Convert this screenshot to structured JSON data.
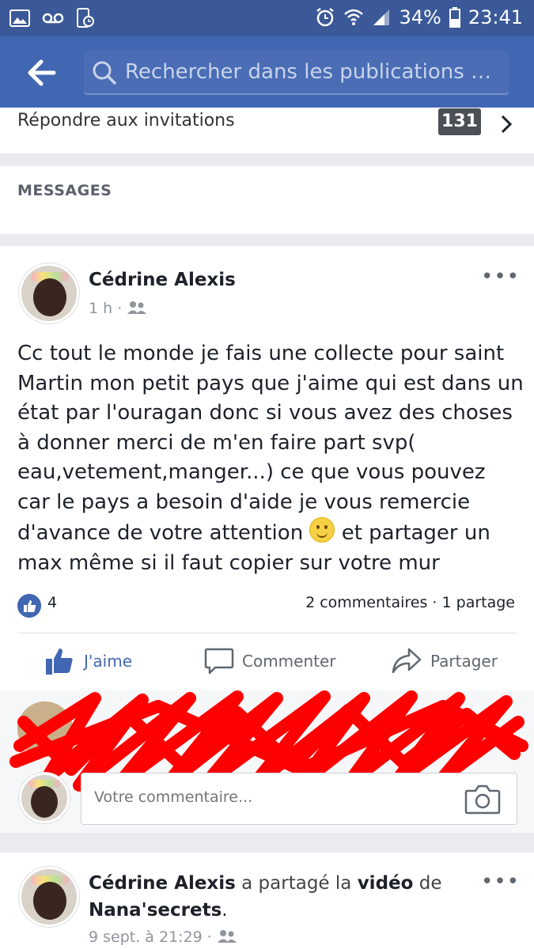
{
  "status_bar": {
    "battery": "34%",
    "time": "23:41"
  },
  "search": {
    "placeholder": "Rechercher dans les publications de..."
  },
  "invitations": {
    "label": "Répondre aux invitations",
    "count": "131"
  },
  "messages_header": "MESSAGES",
  "post1": {
    "author": "Cédrine Alexis",
    "time": "1 h",
    "text_before_emoji": "Cc tout le monde je fais une collecte pour saint Martin  mon petit  pays que j'aime qui est dans un état par l'ouragan donc si vous avez des choses à donner merci de m'en faire part svp( eau,vetement,manger...) ce que vous pouvez car le pays a besoin d'aide je vous remercie d'avance de votre attention",
    "text_after_emoji": " et partager un max même si il faut copier sur votre mur",
    "likes": "4",
    "comments": "2 commentaires",
    "shares": "1 partage",
    "actions": {
      "like": "J'aime",
      "comment": "Commenter",
      "share": "Partager"
    }
  },
  "comment_box": {
    "placeholder": "Votre commentaire..."
  },
  "post2": {
    "author": "Cédrine Alexis",
    "shared_middle": " a partagé la ",
    "shared_object": "vidéo",
    "shared_of": " de ",
    "shared_page": "Nana'secrets",
    "time": "9 sept. à 21:29"
  },
  "colors": {
    "facebook_blue": "#4267b2",
    "status_bar": "#3b5998",
    "redaction": "#ff0000"
  }
}
